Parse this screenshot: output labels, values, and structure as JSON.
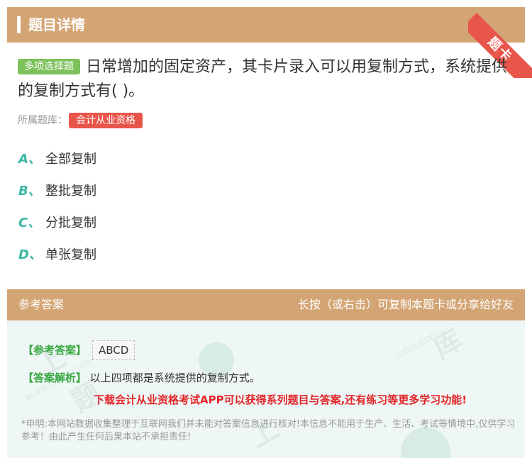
{
  "header": {
    "title": "题目详情",
    "corner_badge": "题卡"
  },
  "question": {
    "type_badge": "多项选择题",
    "text": "日常增加的固定资产，其卡片录入可以用复制方式，系统提供的复制方式有( )。",
    "bank_label": "所属题库：",
    "bank_name": "会计从业资格"
  },
  "options": [
    {
      "letter": "A、",
      "text": "全部复制"
    },
    {
      "letter": "B、",
      "text": "整批复制"
    },
    {
      "letter": "C、",
      "text": "分批复制"
    },
    {
      "letter": "D、",
      "text": "单张复制"
    }
  ],
  "answer": {
    "section_title": "参考答案",
    "hint": "长按（或右击）可复制本题卡或分享给好友",
    "answer_label": "【参考答案】",
    "answer_value": "ABCD",
    "analysis_label": "【答案解析】",
    "analysis_text": "以上四项都是系统提供的复制方式。",
    "promo": "下载会计从业资格考试APP可以获得系列题目与答案,还有练习等更多学习功能!",
    "disclaimer": "*申明:本网站数据收集整理于互联网我们并未能对答案信息进行核对!本信息不能用于生产、生活、考试等情境中,仅供学习参考！由此产生任何后果本站不承担责任!"
  },
  "colors": {
    "header": "#d4a574",
    "accent_red": "#e8554b",
    "accent_green": "#7cc15a",
    "option_letter": "#3cb7a6"
  }
}
